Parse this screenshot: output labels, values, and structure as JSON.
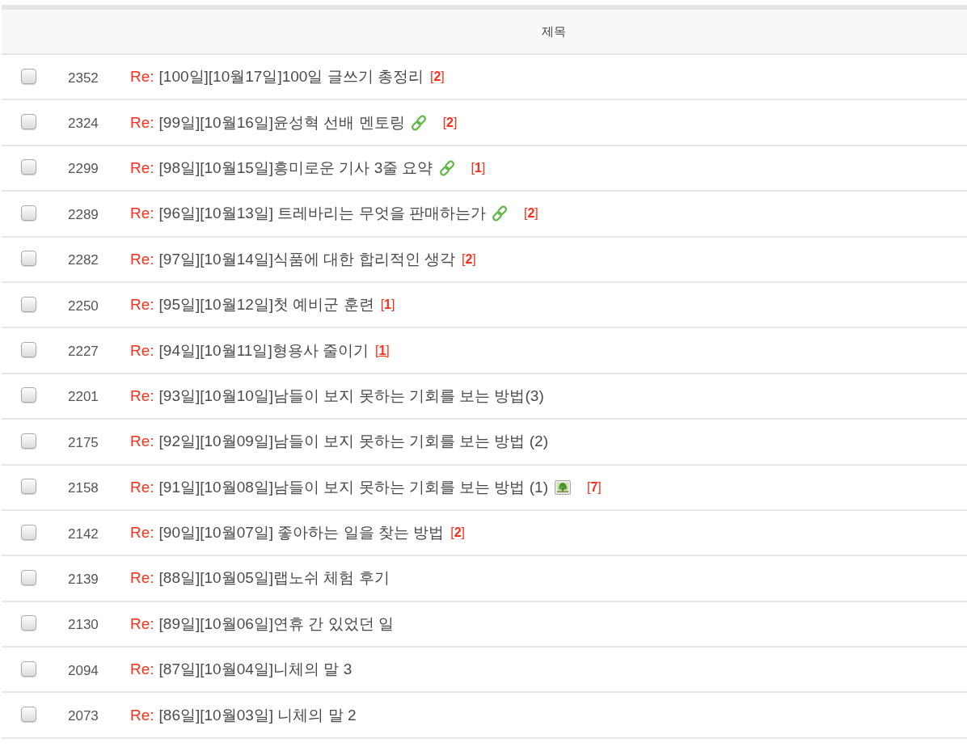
{
  "table": {
    "columns": {
      "title": "제목"
    },
    "rows": [
      {
        "checked": false,
        "number": "2352",
        "prefix": "Re:",
        "title": "[100일][10월17일]100일 글쓰기 총정리",
        "link_icon": false,
        "image_icon": false,
        "comments": {
          "text": "[**2**]",
          "hovered": false
        }
      },
      {
        "checked": false,
        "number": "2324",
        "prefix": "Re:",
        "title": "[99일][10월16일]윤성혁 선배 멘토링",
        "link_icon": true,
        "image_icon": false,
        "comments": {
          "text": "[**2**]",
          "hovered": false
        }
      },
      {
        "checked": false,
        "number": "2299",
        "prefix": "Re:",
        "title": "[98일][10월15일]흥미로운 기사 3줄 요약",
        "link_icon": true,
        "image_icon": false,
        "comments": {
          "text": "[**1**]",
          "hovered": false
        }
      },
      {
        "checked": false,
        "number": "2289",
        "prefix": "Re:",
        "title": "[96일][10월13일] 트레바리는 무엇을 판매하는가",
        "link_icon": true,
        "image_icon": false,
        "comments": {
          "text": "[**2**]",
          "hovered": false
        }
      },
      {
        "checked": false,
        "number": "2282",
        "prefix": "Re:",
        "title": "[97일][10월14일]식품에 대한 합리적인 생각",
        "link_icon": false,
        "image_icon": false,
        "comments": {
          "text": "[**2**]",
          "hovered": false
        }
      },
      {
        "checked": false,
        "number": "2250",
        "prefix": "Re:",
        "title": "[95일][10월12일]첫 예비군 훈련",
        "link_icon": false,
        "image_icon": false,
        "comments": {
          "text": "[**1**]",
          "hovered": false
        }
      },
      {
        "checked": false,
        "number": "2227",
        "prefix": "Re:",
        "title": "[94일][10월11일]형용사 줄이기",
        "link_icon": false,
        "image_icon": false,
        "comments": {
          "text": "[**1**]",
          "hovered": true
        }
      },
      {
        "checked": false,
        "number": "2201",
        "prefix": "Re:",
        "title": "[93일][10월10일]남들이 보지 못하는 기회를 보는 방법(3)",
        "link_icon": false,
        "image_icon": false
      },
      {
        "checked": false,
        "number": "2175",
        "prefix": "Re:",
        "title": "[92일][10월09일]남들이 보지 못하는 기회를 보는 방법 (2)",
        "link_icon": false,
        "image_icon": false
      },
      {
        "checked": false,
        "number": "2158",
        "prefix": "Re:",
        "title": "[91일][10월08일]남들이 보지 못하는 기회를 보는 방법 (1)",
        "link_icon": false,
        "image_icon": true,
        "comments": {
          "text": "[**7**]",
          "hovered": false
        }
      },
      {
        "checked": false,
        "number": "2142",
        "prefix": "Re:",
        "title": "[90일][10월07일] 좋아하는 일을 찾는 방법",
        "link_icon": false,
        "image_icon": false,
        "comments": {
          "text": "[**2**]",
          "hovered": false
        }
      },
      {
        "checked": false,
        "number": "2139",
        "prefix": "Re:",
        "title": "[88일][10월05일]랩노쉬 체험 후기",
        "link_icon": false,
        "image_icon": false
      },
      {
        "checked": false,
        "number": "2130",
        "prefix": "Re:",
        "title": "[89일][10월06일]연휴 간 있었던 일",
        "link_icon": false,
        "image_icon": false
      },
      {
        "checked": false,
        "number": "2094",
        "prefix": "Re:",
        "title": "[87일][10월04일]니체의 말 3",
        "link_icon": false,
        "image_icon": false
      },
      {
        "checked": false,
        "number": "2073",
        "prefix": "Re:",
        "title": "[86일][10월03일] 니체의 말 2",
        "link_icon": false,
        "image_icon": false
      }
    ]
  }
}
